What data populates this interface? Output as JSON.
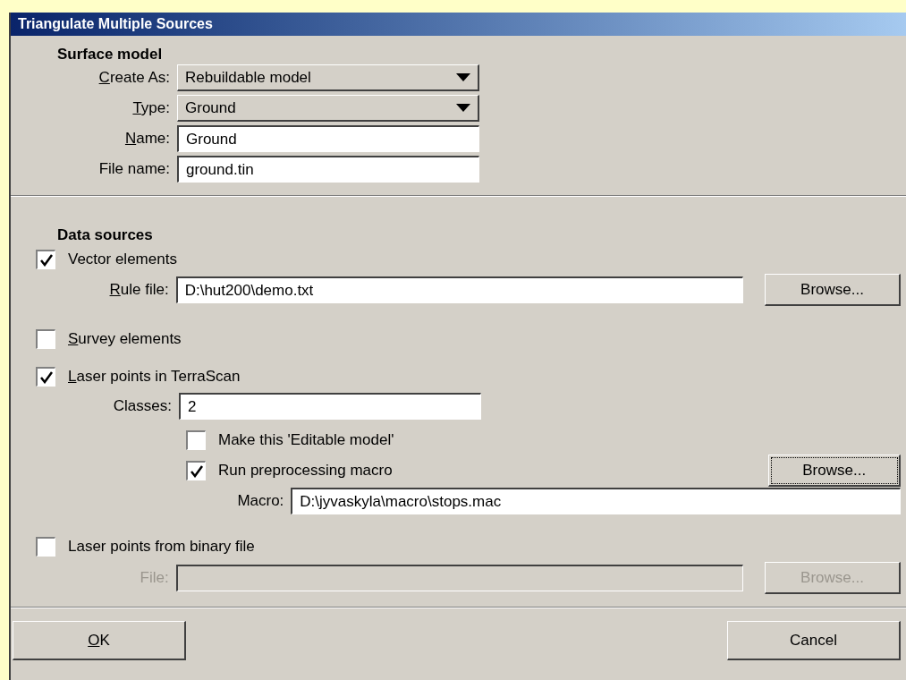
{
  "window": {
    "title": "Triangulate Multiple Sources"
  },
  "surface_model": {
    "heading": "Surface model",
    "fields": [
      {
        "kind": "dropdown",
        "label": "Create As:",
        "underline_first": true,
        "value": "Rebuildable model"
      },
      {
        "kind": "dropdown",
        "label": "Type:",
        "underline_first": true,
        "value": "Ground"
      },
      {
        "kind": "text",
        "label": "Name:",
        "underline_first": true,
        "value": "Ground"
      },
      {
        "kind": "text",
        "label": "File name:",
        "underline_first": false,
        "value": "ground.tin"
      }
    ]
  },
  "data_sources": {
    "heading": "Data sources",
    "vector": {
      "label": "Vector elements",
      "checked": true,
      "underline_first": false,
      "rule_label": "Rule file:",
      "rule_underline_first": true,
      "rule_value": "D:\\hut200\\demo.txt",
      "browse": "Browse..."
    },
    "survey": {
      "label": "Survey elements",
      "checked": false,
      "underline_first": true
    },
    "laser": {
      "label": "Laser points in TerraScan",
      "checked": true,
      "underline_first": true,
      "classes_label": "Classes:",
      "classes_value": "2",
      "editable": {
        "label": "Make this 'Editable model'",
        "checked": false
      },
      "macro": {
        "label": "Run preprocessing macro",
        "checked": true,
        "browse": "Browse...",
        "focused": true,
        "macro_label": "Macro:",
        "macro_value": "D:\\jyvaskyla\\macro\\stops.mac"
      }
    },
    "binary": {
      "label": "Laser points from binary file",
      "checked": false,
      "file_label": "File:",
      "disabled": true,
      "browse": "Browse..."
    }
  },
  "buttons": [
    {
      "label": "OK",
      "underline_first": true
    },
    {
      "label": "Cancel",
      "underline_first": false
    }
  ]
}
